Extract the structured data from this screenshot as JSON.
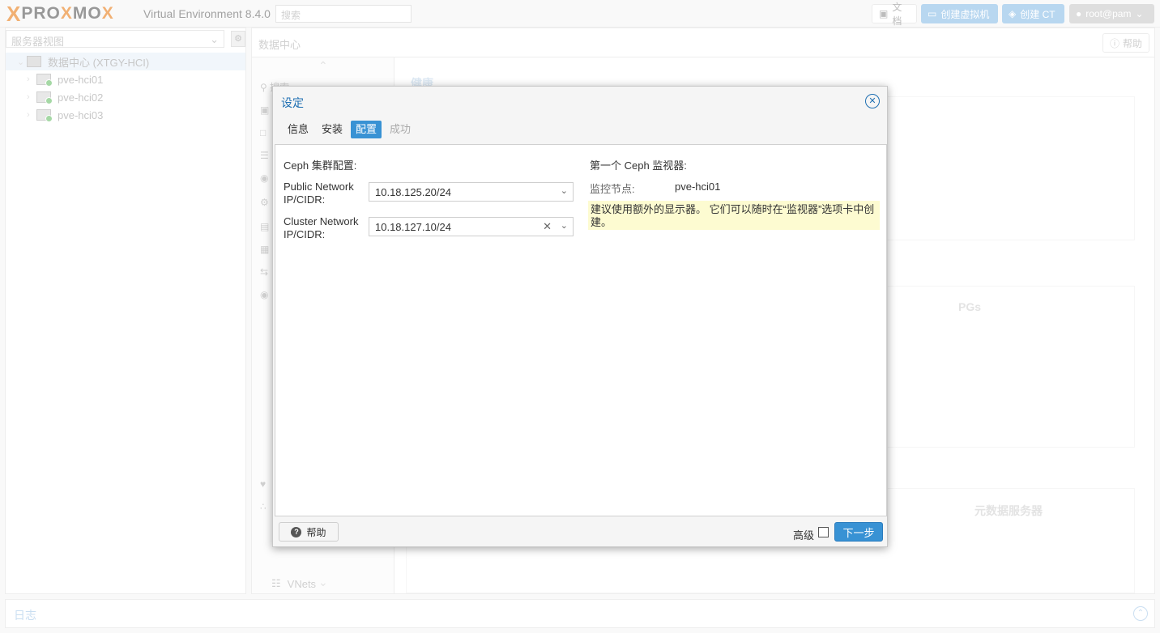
{
  "topbar": {
    "logo_x": "X",
    "logo_brand_1": "PRO",
    "logo_brand_2": "X",
    "logo_brand_3": "MO",
    "logo_brand_4": "X",
    "version_text": "Virtual Environment 8.4.0",
    "search_placeholder": "搜索",
    "docs_label": "文档",
    "create_vm_label": "创建虚拟机",
    "create_ct_label": "创建 CT",
    "user_label": "root@pam"
  },
  "tree": {
    "view_label": "服务器视图",
    "datacenter_label": "数据中心 (XTGY-HCI)",
    "nodes": [
      {
        "label": "pve-hci01"
      },
      {
        "label": "pve-hci02"
      },
      {
        "label": "pve-hci03"
      }
    ]
  },
  "content": {
    "title": "数据中心",
    "help_label": "帮助",
    "nav_search_label": "搜索",
    "nav_vnets_label": "VNets",
    "dash_health_label": "健康",
    "dash_pgs_label": "PGs",
    "dash_mds_label": "元数据服务器"
  },
  "log": {
    "label": "日志"
  },
  "modal": {
    "title": "设定",
    "tabs": [
      {
        "label": "信息"
      },
      {
        "label": "安装"
      },
      {
        "label": "配置"
      },
      {
        "label": "成功"
      }
    ],
    "cluster_config_title": "Ceph 集群配置:",
    "public_network_label_1": "Public Network",
    "public_network_label_2": "IP/CIDR:",
    "public_network_value": "10.18.125.20/24",
    "cluster_network_label_1": "Cluster Network",
    "cluster_network_label_2": "IP/CIDR:",
    "cluster_network_value": "10.18.127.10/24",
    "monitor_title": "第一个 Ceph 监视器:",
    "monitor_node_label": "监控节点:",
    "monitor_node_value": "pve-hci01",
    "hint_text": "建议使用额外的显示器。 它们可以随时在“监视器”选项卡中创建。",
    "help_label": "帮助",
    "advanced_label": "高级",
    "next_label": "下一步"
  },
  "colors": {
    "accent": "#3892d4",
    "logo_orange": "#e57000",
    "hint_bg": "#fdfbd1",
    "status_ok": "#5cb85c"
  }
}
